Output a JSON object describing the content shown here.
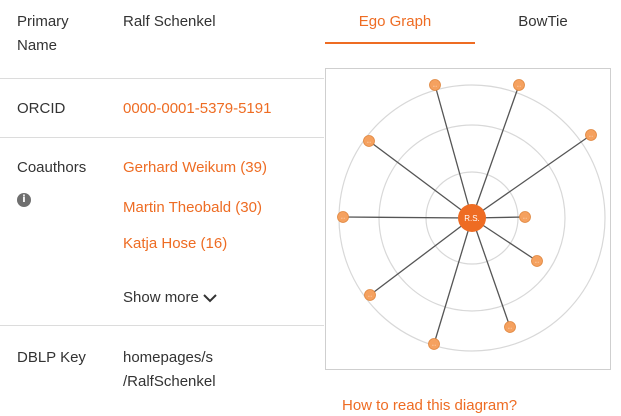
{
  "profile": {
    "primary_name_label_1": "Primary",
    "primary_name_label_2": "Name",
    "primary_name_value": "Ralf Schenkel",
    "orcid_label": "ORCID",
    "orcid_value": "0000-0001-5379-5191",
    "coauthors_label": "Coauthors",
    "coauthors": [
      {
        "label": "Gerhard Weikum (39)"
      },
      {
        "label": "Martin Theobald (30)"
      },
      {
        "label": "Katja Hose (16)"
      }
    ],
    "show_more_label": "Show more",
    "dblp_label": "DBLP Key",
    "dblp_value_line1": "homepages/s",
    "dblp_value_line2": "/RalfSchenkel"
  },
  "tabs": {
    "ego": "Ego Graph",
    "bowtie": "BowTie"
  },
  "graph": {
    "center_label": "R.S.",
    "node_label": "...",
    "help_link": "How to read this diagram?"
  },
  "colors": {
    "accent": "#ee6c23",
    "node_fill": "#f5a15f",
    "text": "#333333"
  }
}
